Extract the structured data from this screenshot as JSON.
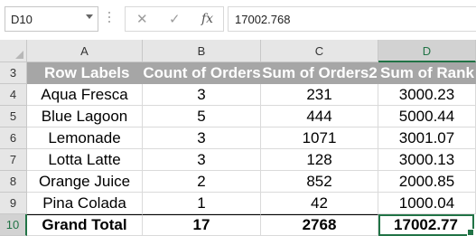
{
  "name_box": {
    "value": "D10"
  },
  "formula_bar": {
    "value": "17002.768",
    "fx_label": "fx",
    "cancel_glyph": "✕",
    "enter_glyph": "✓"
  },
  "columns": [
    "A",
    "B",
    "C",
    "D"
  ],
  "rows": [
    "3",
    "4",
    "5",
    "6",
    "7",
    "8",
    "9",
    "10"
  ],
  "pivot": {
    "headers": [
      "Row Labels",
      "Count of Orders",
      "Sum of Orders2",
      "Sum of Rank"
    ],
    "data": [
      [
        "Aqua Fresca",
        "3",
        "231",
        "3000.23"
      ],
      [
        "Blue Lagoon",
        "5",
        "444",
        "5000.44"
      ],
      [
        "Lemonade",
        "3",
        "1071",
        "3001.07"
      ],
      [
        "Lotta Latte",
        "3",
        "128",
        "3000.13"
      ],
      [
        "Orange Juice",
        "2",
        "852",
        "2000.85"
      ],
      [
        "Pina Colada",
        "1",
        "42",
        "1000.04"
      ]
    ],
    "total": [
      "Grand Total",
      "17",
      "2768",
      "17002.77"
    ]
  },
  "colors": {
    "accent": "#217346",
    "pivot_header_bg": "#a6a6a6"
  },
  "icons": [
    "dropdown-arrow-icon",
    "cancel-icon",
    "enter-icon",
    "fx-icon",
    "filter-icon"
  ]
}
